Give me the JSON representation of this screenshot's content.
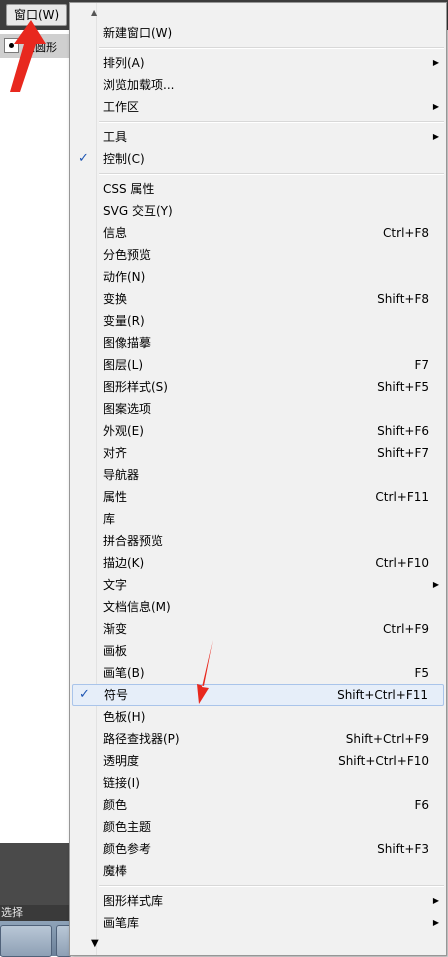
{
  "app": {
    "menu_title": "窗口(W)",
    "control_label": "点圆形",
    "status_text": "选择"
  },
  "colors": {
    "check_blue": "#1e56b3",
    "highlight_bg": "#e6eef9",
    "highlight_border": "#a9c4ea",
    "annotation_red": "#e8281e"
  },
  "icons": {
    "submenu": "submenu-arrow-icon",
    "check": "checkmark-icon",
    "scroll_up": "scroll-up-arrow-icon",
    "scroll_down": "scroll-down-arrow-icon"
  },
  "menu": {
    "scroll_up_glyph": "▲",
    "scroll_down_glyph": "▼",
    "items": [
      {
        "label": "新建窗口(W)"
      },
      {
        "separator": true
      },
      {
        "label": "排列(A)",
        "submenu": true
      },
      {
        "label": "浏览加载项..."
      },
      {
        "label": "工作区",
        "submenu": true
      },
      {
        "separator": true
      },
      {
        "label": "工具",
        "submenu": true
      },
      {
        "label": "控制(C)",
        "checked": true
      },
      {
        "separator": true
      },
      {
        "label": "CSS 属性"
      },
      {
        "label": "SVG 交互(Y)"
      },
      {
        "label": "信息",
        "shortcut": "Ctrl+F8"
      },
      {
        "label": "分色预览"
      },
      {
        "label": "动作(N)"
      },
      {
        "label": "变换",
        "shortcut": "Shift+F8"
      },
      {
        "label": "变量(R)"
      },
      {
        "label": "图像描摹"
      },
      {
        "label": "图层(L)",
        "shortcut": "F7"
      },
      {
        "label": "图形样式(S)",
        "shortcut": "Shift+F5"
      },
      {
        "label": "图案选项"
      },
      {
        "label": "外观(E)",
        "shortcut": "Shift+F6"
      },
      {
        "label": "对齐",
        "shortcut": "Shift+F7"
      },
      {
        "label": "导航器"
      },
      {
        "label": "属性",
        "shortcut": "Ctrl+F11"
      },
      {
        "label": "库"
      },
      {
        "label": "拼合器预览"
      },
      {
        "label": "描边(K)",
        "shortcut": "Ctrl+F10"
      },
      {
        "label": "文字",
        "submenu": true
      },
      {
        "label": "文档信息(M)"
      },
      {
        "label": "渐变",
        "shortcut": "Ctrl+F9"
      },
      {
        "label": "画板"
      },
      {
        "label": "画笔(B)",
        "shortcut": "F5"
      },
      {
        "label": "符号",
        "shortcut": "Shift+Ctrl+F11",
        "checked": true,
        "highlighted": true
      },
      {
        "label": "色板(H)"
      },
      {
        "label": "路径查找器(P)",
        "shortcut": "Shift+Ctrl+F9"
      },
      {
        "label": "透明度",
        "shortcut": "Shift+Ctrl+F10"
      },
      {
        "label": "链接(I)"
      },
      {
        "label": "颜色",
        "shortcut": "F6"
      },
      {
        "label": "颜色主题"
      },
      {
        "label": "颜色参考",
        "shortcut": "Shift+F3"
      },
      {
        "label": "魔棒"
      },
      {
        "separator": true
      },
      {
        "label": "图形样式库",
        "submenu": true
      },
      {
        "label": "画笔库",
        "submenu": true
      }
    ]
  }
}
